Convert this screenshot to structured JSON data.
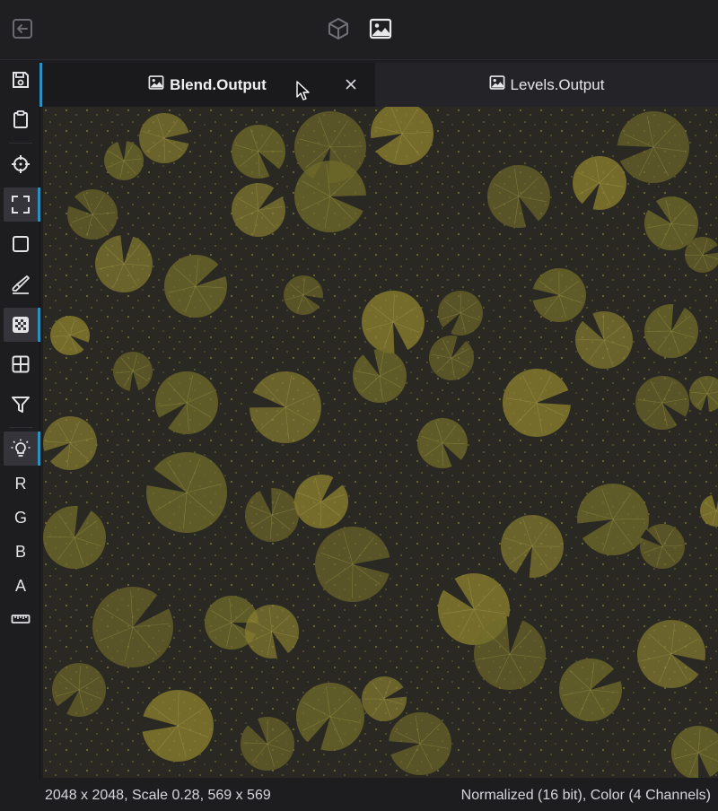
{
  "topbar": {
    "back_icon": "back-arrow-icon",
    "mode_3d_icon": "cube-icon",
    "mode_2d_icon": "image-icon"
  },
  "toolbar": {
    "tools": [
      {
        "icon": "save-icon"
      },
      {
        "icon": "clipboard-icon"
      },
      {
        "icon": "crosshair-icon"
      },
      {
        "icon": "fit-view-icon",
        "active": true
      },
      {
        "icon": "square-icon"
      },
      {
        "icon": "brush-icon"
      },
      {
        "icon": "checkerboard-icon",
        "active": true
      },
      {
        "icon": "grid-icon"
      },
      {
        "icon": "filter-icon"
      },
      {
        "icon": "lightbulb-icon",
        "active": true
      }
    ],
    "channels": {
      "r": "R",
      "g": "G",
      "b": "B",
      "a": "A"
    },
    "ruler_icon": "ruler-icon"
  },
  "tabs": [
    {
      "label": "Blend.Output",
      "active": true
    },
    {
      "label": "Levels.Output",
      "active": false
    }
  ],
  "status": {
    "left": "2048 x 2048, Scale 0.28, 569 x 569",
    "right": "Normalized (16 bit), Color (4 Channels)"
  },
  "colors": {
    "accent": "#2b8fbf",
    "water": "#2a2822",
    "lily_pad": "#8a8030",
    "lily_pad_dark": "#6e6a2a",
    "flowers": "#b5ad4a"
  }
}
